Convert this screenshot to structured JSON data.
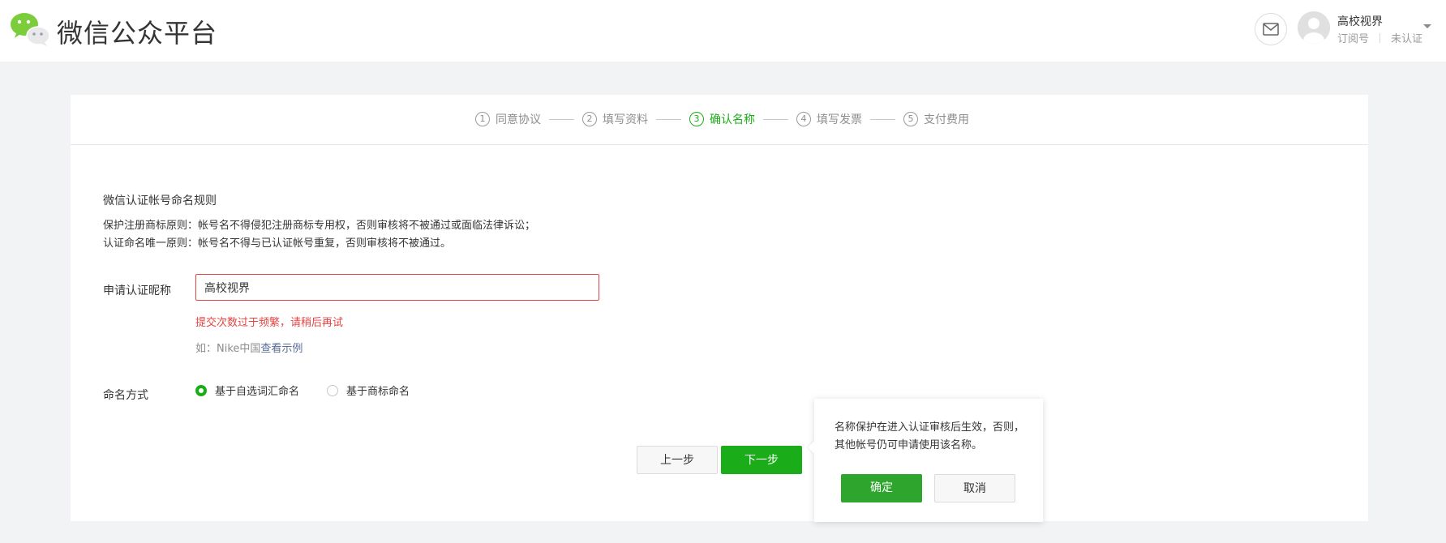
{
  "header": {
    "brand": "微信公众平台",
    "account": {
      "name": "高校视界",
      "type": "订阅号",
      "status": "未认证"
    }
  },
  "steps": [
    {
      "num": "1",
      "label": "同意协议"
    },
    {
      "num": "2",
      "label": "填写资料"
    },
    {
      "num": "3",
      "label": "确认名称"
    },
    {
      "num": "4",
      "label": "填写发票"
    },
    {
      "num": "5",
      "label": "支付费用"
    }
  ],
  "active_step": 3,
  "rules": {
    "title": "微信认证帐号命名规则",
    "line1": "保护注册商标原则：帐号名不得侵犯注册商标专用权，否则审核将不被通过或面临法律诉讼；",
    "line2": "认证命名唯一原则：帐号名不得与已认证帐号重复，否则审核将不被通过。"
  },
  "form": {
    "nickname_label": "申请认证昵称",
    "nickname_value": "高校视界",
    "error_tip": "提交次数过于频繁，请稍后再试",
    "example_prefix": "如：Nike中国",
    "example_link": "查看示例",
    "mode_label": "命名方式",
    "mode_options": [
      "基于自选词汇命名",
      "基于商标命名"
    ],
    "mode_selected": "基于自选词汇命名"
  },
  "buttons": {
    "prev": "上一步",
    "next": "下一步"
  },
  "popover": {
    "text": "名称保护在进入认证审核后生效，否则，其他帐号仍可申请使用该名称。",
    "ok": "确定",
    "cancel": "取消"
  },
  "colors": {
    "primary": "#1aad19",
    "error": "#e64340",
    "link": "#576b95",
    "page_bg": "#f2f3f5"
  }
}
